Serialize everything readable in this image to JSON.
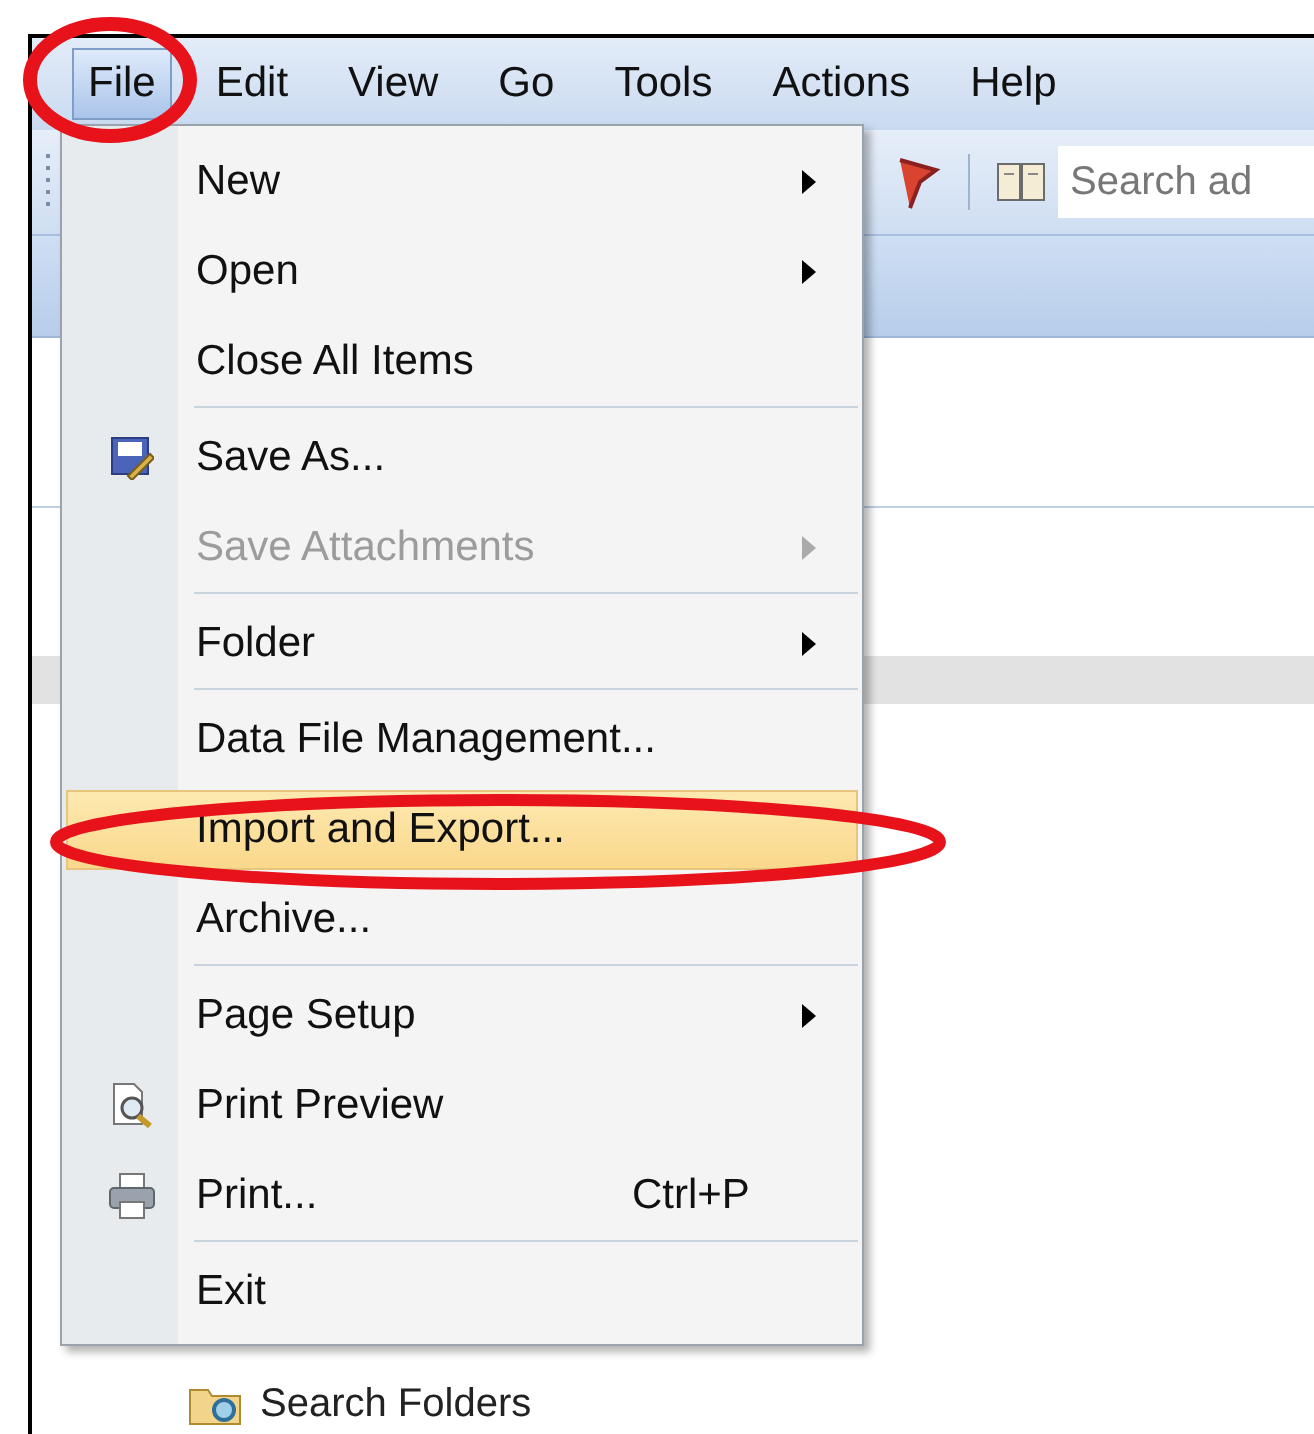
{
  "menu_bar": [
    {
      "label": "File",
      "selected": true
    },
    {
      "label": "Edit",
      "selected": false
    },
    {
      "label": "View",
      "selected": false
    },
    {
      "label": "Go",
      "selected": false
    },
    {
      "label": "Tools",
      "selected": false
    },
    {
      "label": "Actions",
      "selected": false
    },
    {
      "label": "Help",
      "selected": false
    }
  ],
  "toolbar": {
    "search": {
      "placeholder": "Search ad"
    }
  },
  "file_menu": [
    {
      "kind": "item",
      "label": "New",
      "submenu": true,
      "disabled": false,
      "selected": false
    },
    {
      "kind": "item",
      "label": "Open",
      "submenu": true,
      "disabled": false,
      "selected": false
    },
    {
      "kind": "item",
      "label": "Close All Items",
      "submenu": false,
      "disabled": false,
      "selected": false
    },
    {
      "kind": "separator"
    },
    {
      "kind": "item",
      "label": "Save As...",
      "submenu": false,
      "disabled": false,
      "selected": false
    },
    {
      "kind": "item",
      "label": "Save Attachments",
      "submenu": true,
      "disabled": true,
      "selected": false
    },
    {
      "kind": "separator"
    },
    {
      "kind": "item",
      "label": "Folder",
      "submenu": true,
      "disabled": false,
      "selected": false
    },
    {
      "kind": "separator"
    },
    {
      "kind": "item",
      "label": "Data File Management...",
      "submenu": false,
      "disabled": false,
      "selected": false
    },
    {
      "kind": "item",
      "label": "Import and Export...",
      "submenu": false,
      "disabled": false,
      "selected": true
    },
    {
      "kind": "item",
      "label": "Archive...",
      "submenu": false,
      "disabled": false,
      "selected": false
    },
    {
      "kind": "separator"
    },
    {
      "kind": "item",
      "label": "Page Setup",
      "submenu": true,
      "disabled": false,
      "selected": false
    },
    {
      "kind": "item",
      "label": "Print Preview",
      "submenu": false,
      "disabled": false,
      "selected": false
    },
    {
      "kind": "item",
      "label": "Print...",
      "shortcut": "Ctrl+P",
      "submenu": false,
      "disabled": false,
      "selected": false
    },
    {
      "kind": "separator"
    },
    {
      "kind": "item",
      "label": "Exit",
      "submenu": false,
      "disabled": false,
      "selected": false
    }
  ],
  "navigation": {
    "folder_label": "Search Folders"
  }
}
